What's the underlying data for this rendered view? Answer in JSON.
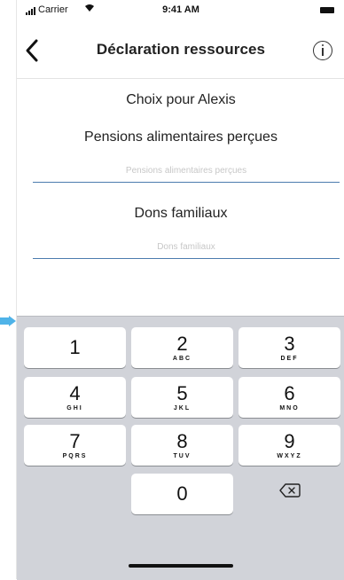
{
  "status_bar": {
    "carrier": "Carrier",
    "time": "9:41 AM"
  },
  "nav": {
    "title": "Déclaration ressources"
  },
  "content": {
    "choice_title": "Choix pour Alexis",
    "pension_label": "Pensions alimentaires perçues",
    "pension_placeholder": "Pensions alimentaires perçues",
    "pension_value": "",
    "gifts_label": "Dons familiaux",
    "gifts_placeholder": "Dons familiaux",
    "gifts_value": ""
  },
  "keyboard": {
    "keys": [
      {
        "num": "1",
        "letters": ""
      },
      {
        "num": "2",
        "letters": "ABC"
      },
      {
        "num": "3",
        "letters": "DEF"
      },
      {
        "num": "4",
        "letters": "GHI"
      },
      {
        "num": "5",
        "letters": "JKL"
      },
      {
        "num": "6",
        "letters": "MNO"
      },
      {
        "num": "7",
        "letters": "PQRS"
      },
      {
        "num": "8",
        "letters": "TUV"
      },
      {
        "num": "9",
        "letters": "WXYZ"
      },
      {
        "num": "0",
        "letters": ""
      }
    ]
  },
  "colors": {
    "accent": "#4c7cae",
    "pointer": "#4fb3e8",
    "keyboard_bg": "#d1d3d9"
  }
}
